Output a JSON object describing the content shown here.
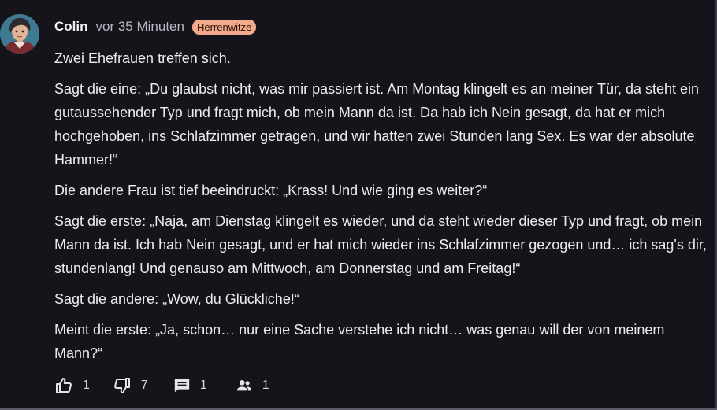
{
  "post": {
    "author": "Colin",
    "time": "vor 35 Minuten",
    "tag": "Herrenwitze",
    "paragraphs": [
      "Zwei Ehefrauen treffen sich.",
      "Sagt die eine: „Du glaubst nicht, was mir passiert ist. Am Montag klingelt es an meiner Tür, da steht ein gutaussehender Typ und fragt mich, ob mein Mann da ist. Da hab ich Nein gesagt, da hat er mich hochgehoben, ins Schlafzimmer getragen, und wir hatten zwei Stunden lang Sex. Es war der absolute Hammer!“",
      "Die andere Frau ist tief beeindruckt: „Krass! Und wie ging es weiter?“",
      "Sagt die erste: „Naja, am Dienstag klingelt es wieder, und da steht wieder dieser Typ und fragt, ob mein Mann da ist. Ich hab Nein gesagt, und er hat mich wieder ins Schlafzimmer gezogen und… ich sag's dir, stundenlang! Und genauso am Mittwoch, am Donnerstag und am Freitag!“",
      "Sagt die andere: „Wow, du Glückliche!“",
      "Meint die erste: „Ja, schon… nur eine Sache verstehe ich nicht… was genau will der von meinem Mann?“"
    ]
  },
  "actions": {
    "upvotes": "1",
    "downvotes": "7",
    "comments": "1",
    "followers": "1"
  },
  "icons": {
    "upvote": "thumbs-up-icon",
    "downvote": "thumbs-down-icon",
    "comment": "comment-icon",
    "followers": "users-icon"
  },
  "colors": {
    "background": "#15141a",
    "tag_background": "#f3a98c",
    "text": "#ececf0"
  }
}
